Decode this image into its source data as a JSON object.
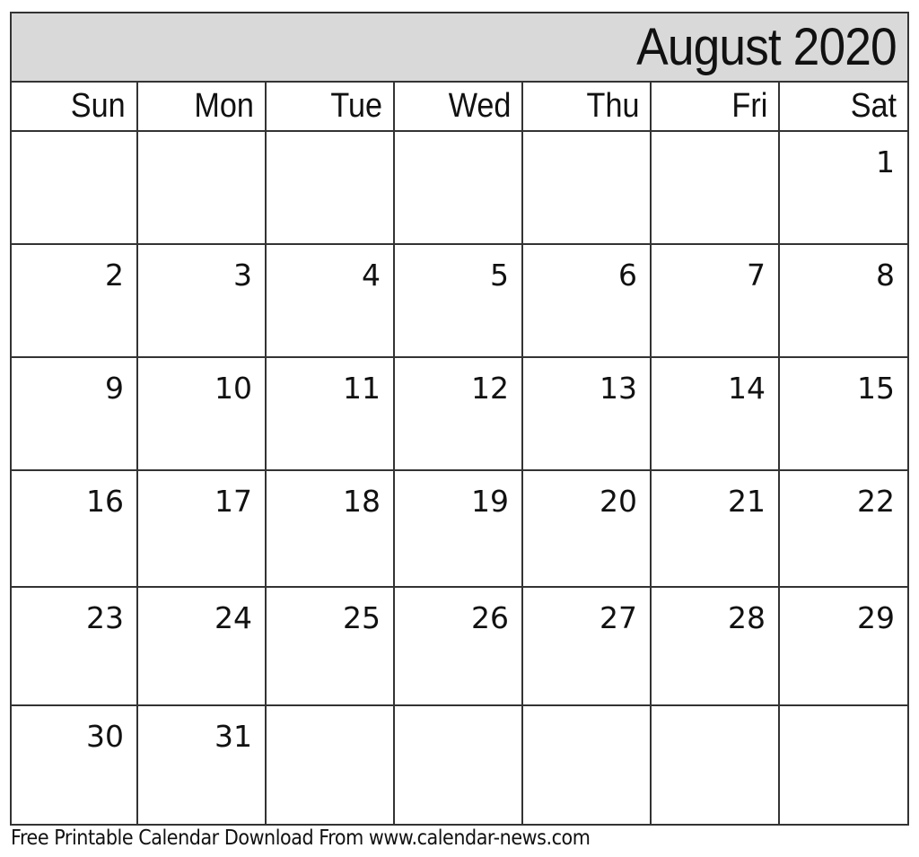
{
  "calendar": {
    "title": "August 2020",
    "month": "August",
    "year": 2020,
    "weekdays": [
      "Sun",
      "Mon",
      "Tue",
      "Wed",
      "Thu",
      "Fri",
      "Sat"
    ],
    "weeks": [
      [
        "",
        "",
        "",
        "",
        "",
        "",
        "1"
      ],
      [
        "2",
        "3",
        "4",
        "5",
        "6",
        "7",
        "8"
      ],
      [
        "9",
        "10",
        "11",
        "12",
        "13",
        "14",
        "15"
      ],
      [
        "16",
        "17",
        "18",
        "19",
        "20",
        "21",
        "22"
      ],
      [
        "23",
        "24",
        "25",
        "26",
        "27",
        "28",
        "29"
      ],
      [
        "30",
        "31",
        "",
        "",
        "",
        "",
        ""
      ]
    ],
    "header_bg_color": "#d9d9d9",
    "grid_line_color": "#333333"
  },
  "footer": {
    "text": "Free Printable Calendar Download From www.calendar-news.com"
  }
}
